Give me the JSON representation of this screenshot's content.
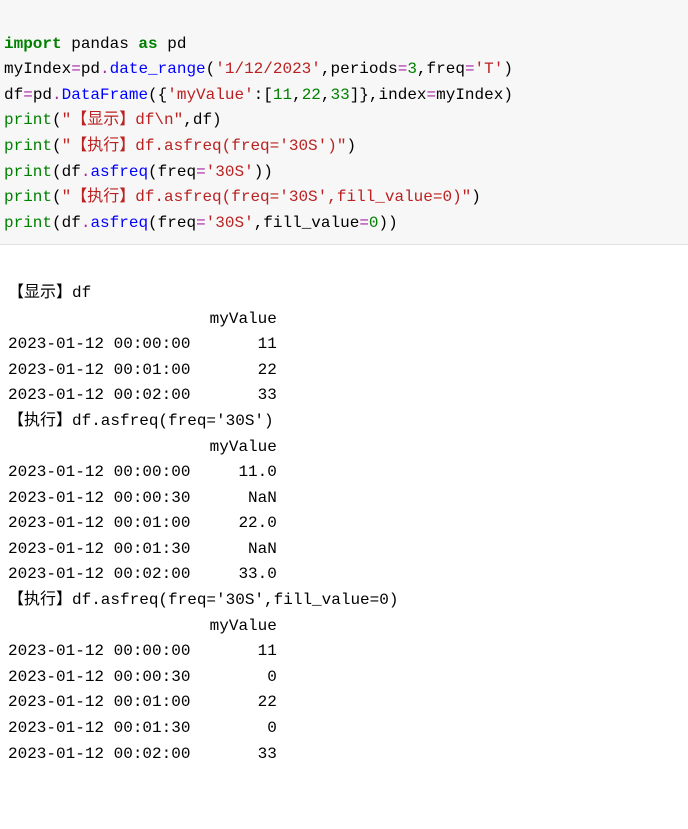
{
  "code": {
    "l1_t1": "import",
    "l1_t2": " pandas ",
    "l1_t3": "as",
    "l1_t4": " pd",
    "l2_t1": "myIndex",
    "l2_t2": "=",
    "l2_t3": "pd",
    "l2_t4": ".",
    "l2_t5": "date_range",
    "l2_t6": "(",
    "l2_t7": "'1/12/2023'",
    "l2_t8": ",periods",
    "l2_t9": "=",
    "l2_t10": "3",
    "l2_t11": ",freq",
    "l2_t12": "=",
    "l2_t13": "'T'",
    "l2_t14": ")",
    "l3_t1": "df",
    "l3_t2": "=",
    "l3_t3": "pd",
    "l3_t4": ".",
    "l3_t5": "DataFrame",
    "l3_t6": "({",
    "l3_t7": "'myValue'",
    "l3_t8": ":[",
    "l3_t9": "11",
    "l3_t10": ",",
    "l3_t11": "22",
    "l3_t12": ",",
    "l3_t13": "33",
    "l3_t14": "]},index",
    "l3_t15": "=",
    "l3_t16": "myIndex)",
    "l4_t1": "print",
    "l4_t2": "(",
    "l4_t3": "\"【显示】df\\n\"",
    "l4_t4": ",df)",
    "l5_t1": "print",
    "l5_t2": "(",
    "l5_t3": "\"【执行】df.asfreq(freq='30S')\"",
    "l5_t4": ")",
    "l6_t1": "print",
    "l6_t2": "(df",
    "l6_t3": ".",
    "l6_t4": "asfreq",
    "l6_t5": "(freq",
    "l6_t6": "=",
    "l6_t7": "'30S'",
    "l6_t8": "))",
    "l7_t1": "print",
    "l7_t2": "(",
    "l7_t3": "\"【执行】df.asfreq(freq='30S',fill_value=0)\"",
    "l7_t4": ")",
    "l8_t1": "print",
    "l8_t2": "(df",
    "l8_t3": ".",
    "l8_t4": "asfreq",
    "l8_t5": "(freq",
    "l8_t6": "=",
    "l8_t7": "'30S'",
    "l8_t8": ",fill_value",
    "l8_t9": "=",
    "l8_t10": "0",
    "l8_t11": "))"
  },
  "out": {
    "l1": "【显示】df",
    "l2": "                     myValue",
    "l3": "2023-01-12 00:00:00       11",
    "l4": "2023-01-12 00:01:00       22",
    "l5": "2023-01-12 00:02:00       33",
    "l6": "【执行】df.asfreq(freq='30S')",
    "l7": "                     myValue",
    "l8": "2023-01-12 00:00:00     11.0",
    "l9": "2023-01-12 00:00:30      NaN",
    "l10": "2023-01-12 00:01:00     22.0",
    "l11": "2023-01-12 00:01:30      NaN",
    "l12": "2023-01-12 00:02:00     33.0",
    "l13": "【执行】df.asfreq(freq='30S',fill_value=0)",
    "l14": "                     myValue",
    "l15": "2023-01-12 00:00:00       11",
    "l16": "2023-01-12 00:00:30        0",
    "l17": "2023-01-12 00:01:00       22",
    "l18": "2023-01-12 00:01:30        0",
    "l19": "2023-01-12 00:02:00       33"
  }
}
